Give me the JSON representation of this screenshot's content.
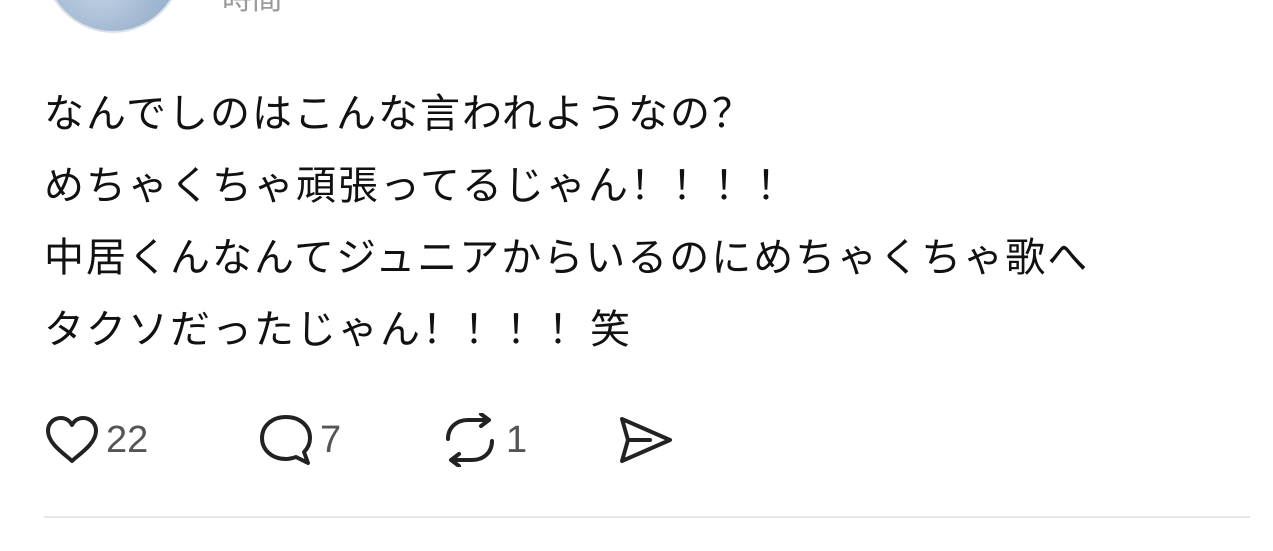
{
  "post": {
    "timestamp": "時間",
    "lines": [
      "なんでしのはこんな言われようなの？",
      "めちゃくちゃ頑張ってるじゃん！！！！",
      "中居くんなんてジュニアからいるのにめちゃくちゃ歌へ",
      "タクソだったじゃん！！！！笑"
    ]
  },
  "actions": {
    "like_count": "22",
    "reply_count": "7",
    "repost_count": "1"
  },
  "icons": {
    "like": "heart-icon",
    "reply": "speech-bubble-icon",
    "repost": "repost-icon",
    "share": "send-icon"
  }
}
